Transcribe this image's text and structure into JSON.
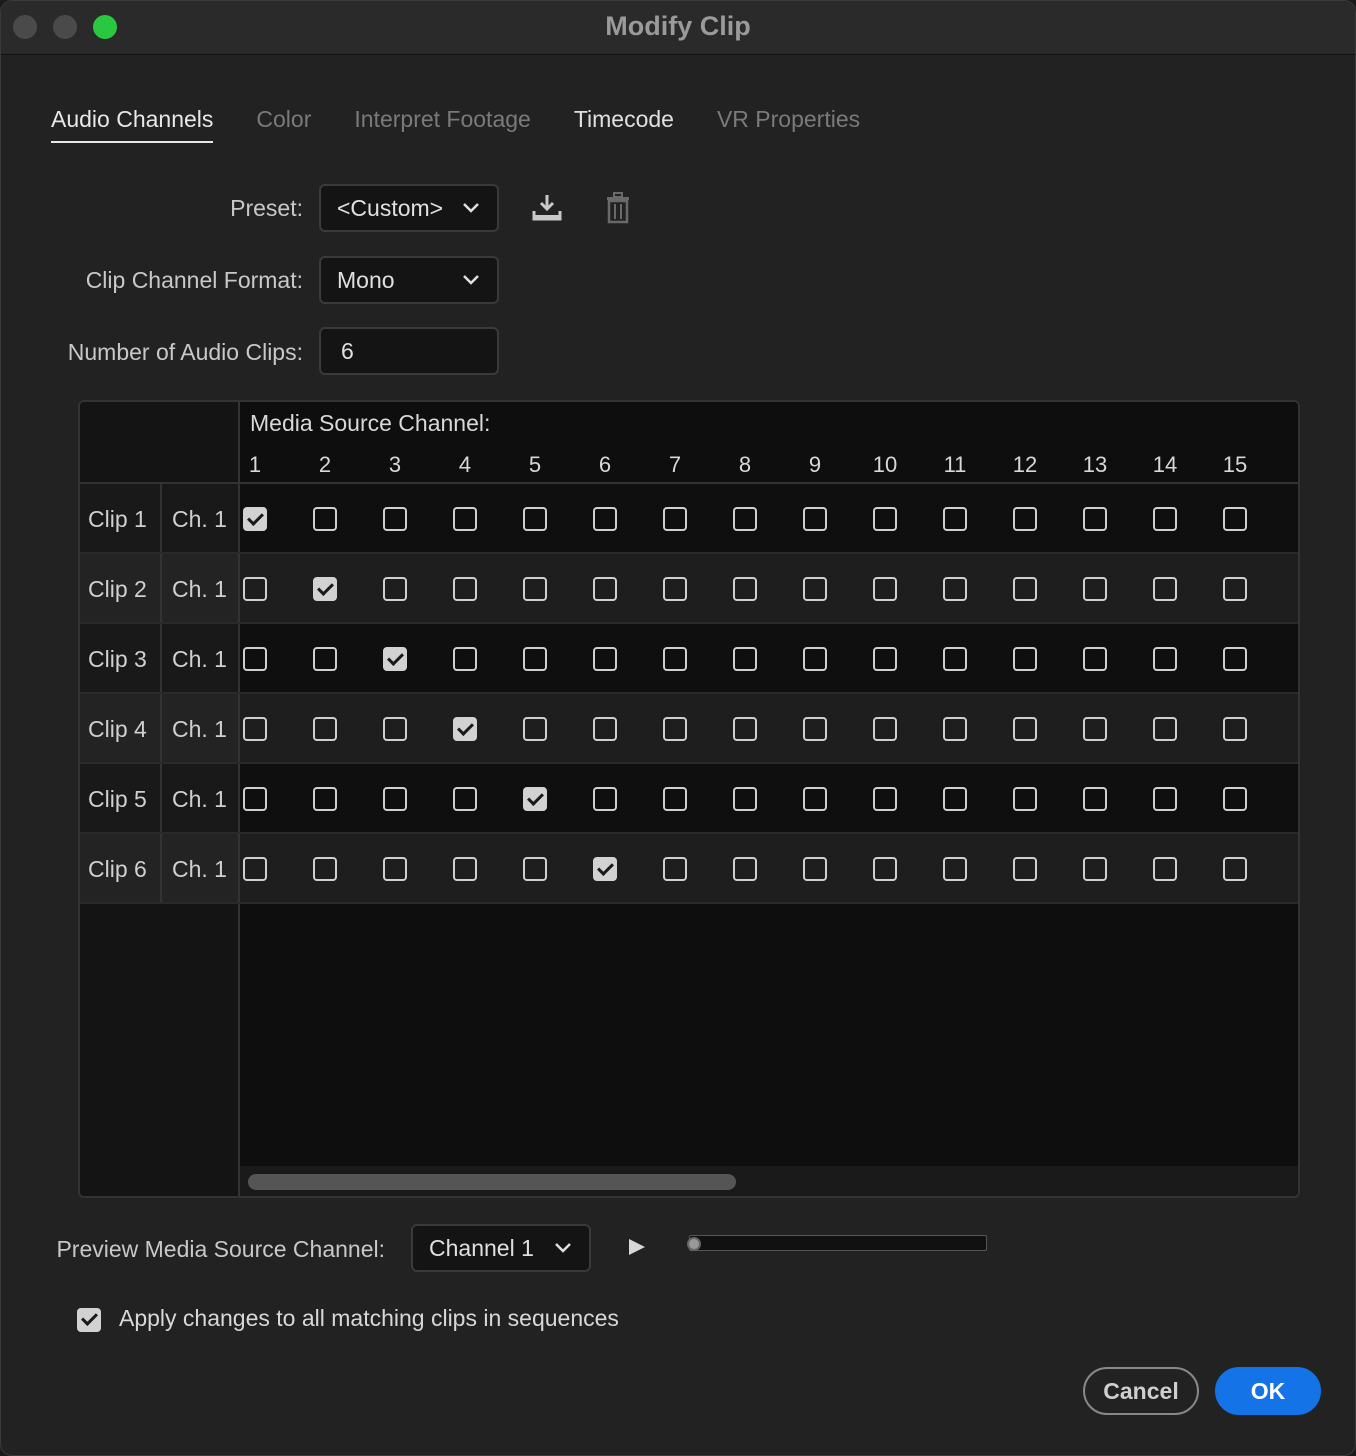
{
  "window": {
    "title": "Modify Clip"
  },
  "tabs": [
    {
      "label": "Audio Channels",
      "state": "active"
    },
    {
      "label": "Color",
      "state": "dim"
    },
    {
      "label": "Interpret Footage",
      "state": "dim"
    },
    {
      "label": "Timecode",
      "state": "bright"
    },
    {
      "label": "VR Properties",
      "state": "dim"
    }
  ],
  "preset": {
    "label": "Preset:",
    "value": "<Custom>",
    "save_icon": "save-preset-icon",
    "delete_icon": "trash-icon"
  },
  "clip_channel_format": {
    "label": "Clip Channel Format:",
    "value": "Mono"
  },
  "num_audio_clips": {
    "label": "Number of Audio Clips:",
    "value": "6"
  },
  "grid": {
    "header_label": "Media Source Channel:",
    "columns": [
      "1",
      "2",
      "3",
      "4",
      "5",
      "6",
      "7",
      "8",
      "9",
      "10",
      "11",
      "12",
      "13",
      "14",
      "15"
    ],
    "rows": [
      {
        "clip": "Clip 1",
        "channel": "Ch. 1",
        "checked_index": 0
      },
      {
        "clip": "Clip 2",
        "channel": "Ch. 1",
        "checked_index": 1
      },
      {
        "clip": "Clip 3",
        "channel": "Ch. 1",
        "checked_index": 2
      },
      {
        "clip": "Clip 4",
        "channel": "Ch. 1",
        "checked_index": 3
      },
      {
        "clip": "Clip 5",
        "channel": "Ch. 1",
        "checked_index": 4
      },
      {
        "clip": "Clip 6",
        "channel": "Ch. 1",
        "checked_index": 5
      }
    ]
  },
  "preview": {
    "label": "Preview Media Source Channel:",
    "value": "Channel 1",
    "progress": 0
  },
  "apply": {
    "label": "Apply changes to all matching clips in sequences",
    "checked": true
  },
  "buttons": {
    "cancel": "Cancel",
    "ok": "OK"
  },
  "colors": {
    "accent": "#1473e6",
    "maximize": "#2ac840",
    "background": "#222222"
  }
}
